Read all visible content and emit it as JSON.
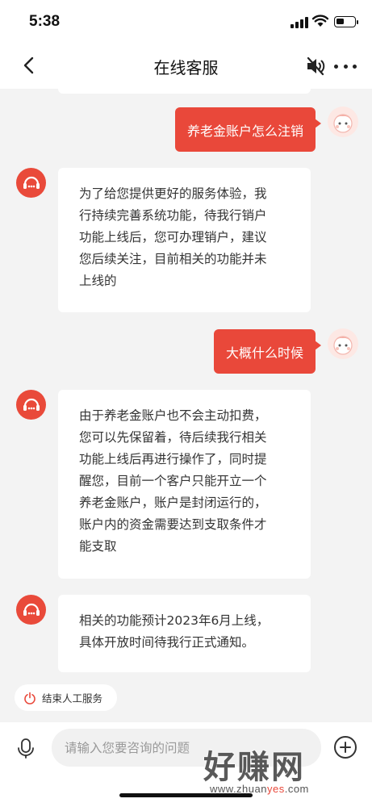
{
  "status_bar": {
    "time": "5:38",
    "battery_level": 0.45
  },
  "nav": {
    "title": "在线客服",
    "icons": [
      "back-arrow-icon",
      "speaker-mute-icon",
      "more-icon"
    ]
  },
  "messages": [
    {
      "sender": "user",
      "text": "养老金账户怎么注销"
    },
    {
      "sender": "agent",
      "lines": [
        "为了给您提供更好的服务体验，我",
        "行持续完善系统功能，待我行销户",
        "功能上线后，您可办理销户，建议",
        "您后续关注，目前相关的功能并未",
        "上线的"
      ]
    },
    {
      "sender": "user",
      "text": "大概什么时候"
    },
    {
      "sender": "agent",
      "lines": [
        "由于养老金账户也不会主动扣费，",
        "您可以先保留着，待后续我行相关",
        "功能上线后再进行操作了，同时提",
        "醒您，目前一个客户只能开立一个",
        "养老金账户，账户是封闭运行的，",
        "账户内的资金需要达到支取条件才",
        "能支取"
      ]
    },
    {
      "sender": "agent",
      "lines": [
        "相关的功能预计2023年6月上线，",
        "具体开放时间待我行正式通知。"
      ]
    }
  ],
  "end_service": {
    "label": "结束人工服务"
  },
  "input": {
    "placeholder": "请输入您要咨询的问题"
  },
  "watermark": {
    "main": "好赚网",
    "sub_prefix": "www.zhuan",
    "sub_accent": "yes",
    "sub_suffix": ".com"
  },
  "colors": {
    "accent": "#e9483a",
    "background": "#f3f3f3"
  }
}
